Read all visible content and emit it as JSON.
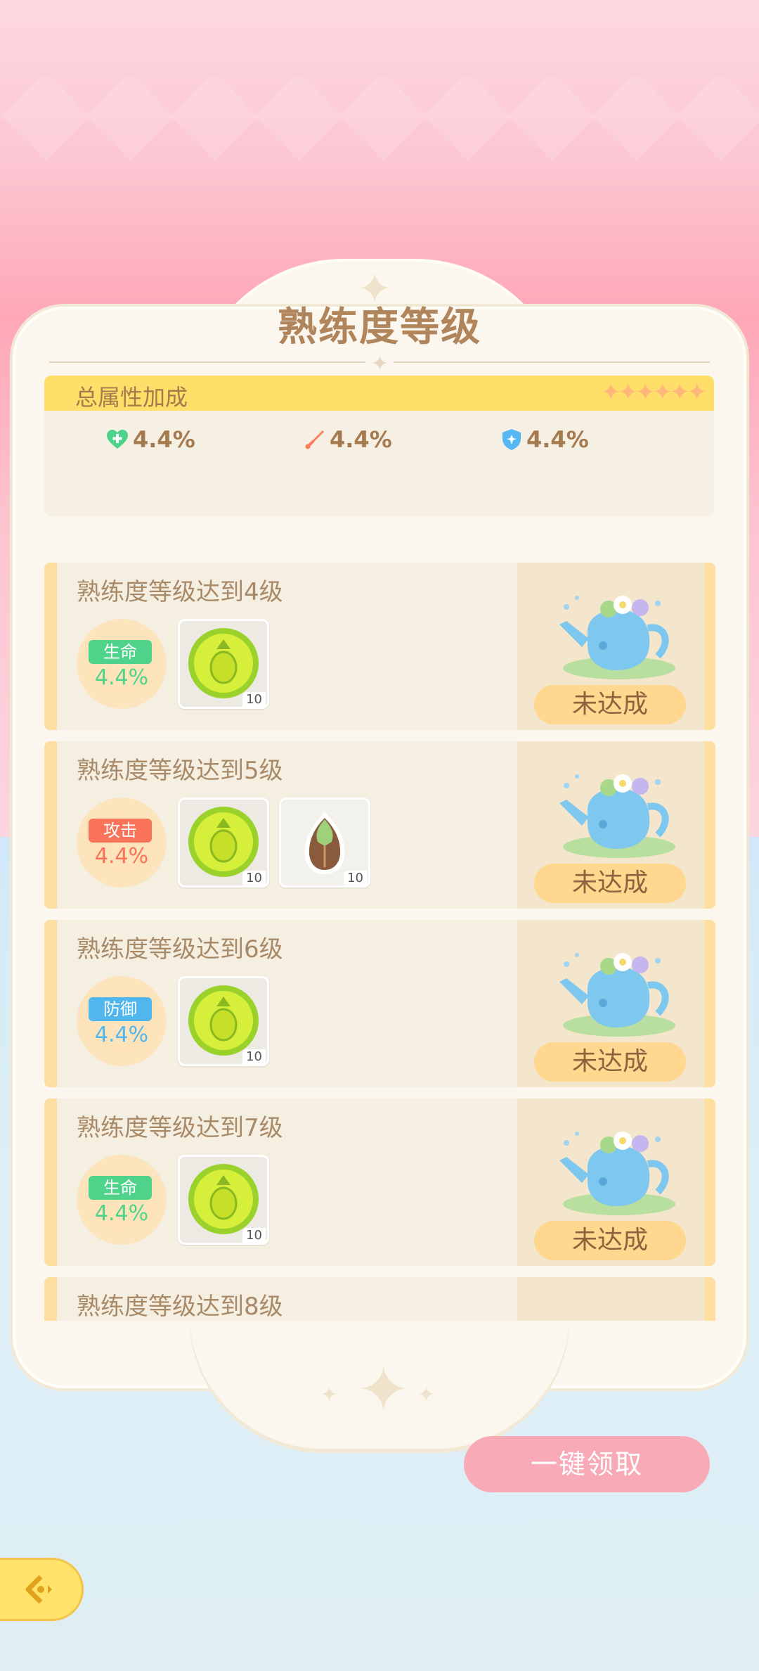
{
  "title": "熟练度等级",
  "total_bonus": {
    "label": "总属性加成",
    "stars": "✦✦✦✦✦✦",
    "stats": [
      {
        "icon": "heart-plus-icon",
        "value": "4.4%",
        "color": "#4fd38a"
      },
      {
        "icon": "sword-icon",
        "value": "4.4%",
        "color": "#ff7a5a"
      },
      {
        "icon": "shield-icon",
        "value": "4.4%",
        "color": "#55b8f2"
      }
    ]
  },
  "milestones": [
    {
      "title": "熟练度等级达到4级",
      "bonus_type": "生命",
      "bonus_value": "4.4%",
      "bonus_color": "#4fd38a",
      "rewards": [
        {
          "icon": "pineapple-coin-icon",
          "qty": "10"
        }
      ],
      "status": "未达成"
    },
    {
      "title": "熟练度等级达到5级",
      "bonus_type": "攻击",
      "bonus_value": "4.4%",
      "bonus_color": "#f9735a",
      "rewards": [
        {
          "icon": "pineapple-coin-icon",
          "qty": "10"
        },
        {
          "icon": "seed-icon",
          "qty": "10"
        }
      ],
      "status": "未达成"
    },
    {
      "title": "熟练度等级达到6级",
      "bonus_type": "防御",
      "bonus_value": "4.4%",
      "bonus_color": "#4fb7ee",
      "rewards": [
        {
          "icon": "pineapple-coin-icon",
          "qty": "10"
        }
      ],
      "status": "未达成"
    },
    {
      "title": "熟练度等级达到7级",
      "bonus_type": "生命",
      "bonus_value": "4.4%",
      "bonus_color": "#4fd38a",
      "rewards": [
        {
          "icon": "pineapple-coin-icon",
          "qty": "10"
        }
      ],
      "status": "未达成"
    },
    {
      "title": "熟练度等级达到8级"
    }
  ],
  "claim_all_label": "一键领取",
  "back_icon": "back-arrow-icon"
}
